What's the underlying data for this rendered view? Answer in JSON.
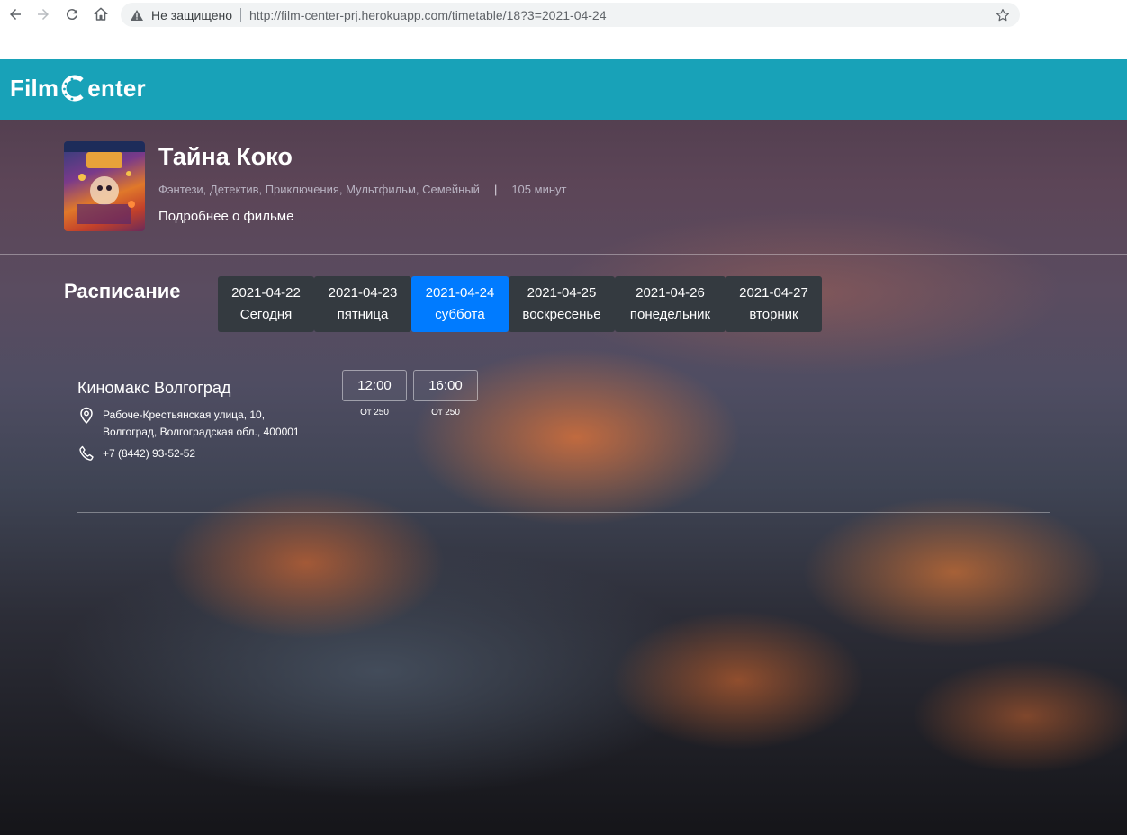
{
  "browser": {
    "insecure_label": "Не защищено",
    "url": "http://film-center-prj.herokuapp.com/timetable/18?3=2021-04-24"
  },
  "site": {
    "logo_left": "Film",
    "logo_right": "enter"
  },
  "movie": {
    "title": "Тайна Коко",
    "genres": "Фэнтези, Детектив, Приключения, Мультфильм, Семейный",
    "separator": "|",
    "duration": "105 минут",
    "more_link": "Подробнее о фильме"
  },
  "schedule": {
    "heading": "Расписание",
    "dates": [
      {
        "date": "2021-04-22",
        "day": "Сегодня",
        "active": false
      },
      {
        "date": "2021-04-23",
        "day": "пятница",
        "active": false
      },
      {
        "date": "2021-04-24",
        "day": "суббота",
        "active": true
      },
      {
        "date": "2021-04-25",
        "day": "воскресенье",
        "active": false
      },
      {
        "date": "2021-04-26",
        "day": "понедельник",
        "active": false
      },
      {
        "date": "2021-04-27",
        "day": "вторник",
        "active": false
      }
    ]
  },
  "cinema": {
    "name": "Киномакс Волгоград",
    "address_line1": "Рабоче-Крестьянская улица, 10,",
    "address_line2": "Волгоград, Волгоградская обл., 400001",
    "phone": "+7 (8442) 93-52-52",
    "sessions": [
      {
        "time": "12:00",
        "price": "От 250"
      },
      {
        "time": "16:00",
        "price": "От 250"
      }
    ]
  },
  "colors": {
    "header": "#18a2b8",
    "active_tab": "#007bff",
    "tab": "#343a40"
  },
  "icons": [
    "back-arrow-icon",
    "forward-arrow-icon",
    "reload-icon",
    "home-icon",
    "warning-icon",
    "star-icon",
    "film-reel-icon",
    "location-pin-icon",
    "phone-icon"
  ]
}
